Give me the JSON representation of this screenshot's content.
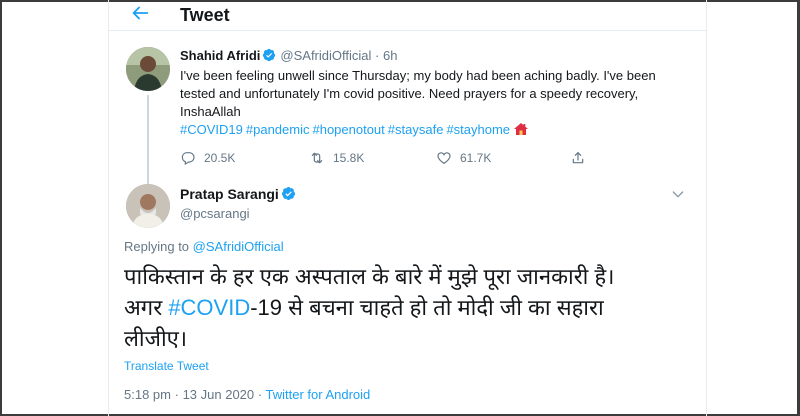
{
  "header": {
    "title": "Tweet"
  },
  "original": {
    "name": "Shahid Afridi",
    "handle": "@SAfridiOfficial",
    "sep": "·",
    "time": "6h",
    "text": "I've been feeling unwell since Thursday; my body had been aching badly. I've been tested and unfortunately I'm covid positive. Need prayers for a speedy recovery, InshaAllah",
    "hashtags": [
      "#COVID19",
      "#pandemic",
      "#hopenotout",
      "#staysafe",
      "#stayhome"
    ],
    "replies": "20.5K",
    "retweets": "15.8K",
    "likes": "61.7K"
  },
  "reply": {
    "name": "Pratap Sarangi",
    "handle": "@pcsarangi",
    "replying_prefix": "Replying to",
    "replying_to": "@SAfridiOfficial",
    "text_line1": "पाकिस्तान के हर एक अस्पताल के बारे में मुझे पूरा जानकारी है।",
    "text_line2_pre": "अगर ",
    "text_line2_link": "#COVID",
    "text_line2_post": "-19 से बचना चाहते हो तो मोदी जी का सहारा",
    "text_line3": "लीजीए।",
    "translate": "Translate Tweet",
    "time": "5:18 pm",
    "date_sep": "·",
    "date": "13 Jun 2020",
    "source_sep": "·",
    "source": "Twitter for Android"
  },
  "colors": {
    "accent": "#1da1f2",
    "muted": "#657786",
    "text": "#14171a",
    "border": "#e6ecf0"
  },
  "icons": [
    "back-arrow-icon",
    "verified-badge-icon",
    "house-emoji-icon",
    "reply-icon",
    "retweet-icon",
    "like-icon",
    "share-icon",
    "chevron-down-icon"
  ]
}
